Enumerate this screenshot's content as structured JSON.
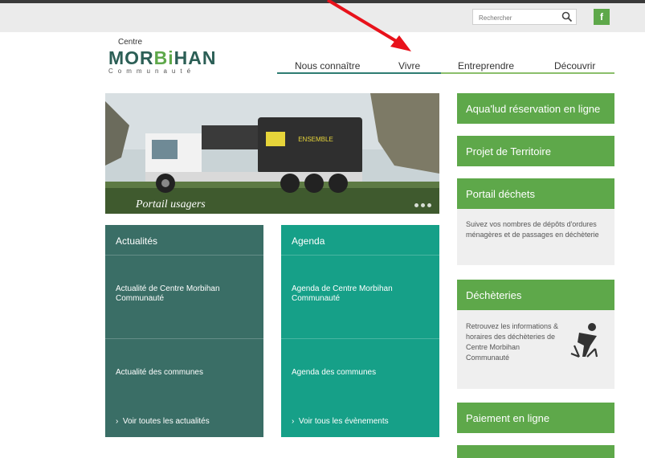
{
  "search": {
    "placeholder": "Rechercher"
  },
  "social": {
    "facebook_label": "f"
  },
  "logo": {
    "line1": "Centre",
    "line2a": "MOR",
    "line2b": "Bi",
    "line2c": "HAN",
    "line3": "Communauté"
  },
  "nav": {
    "items": [
      "Nous connaître",
      "Vivre",
      "Entreprendre",
      "Découvrir"
    ]
  },
  "hero": {
    "caption": "Portail usagers",
    "truck_text": "ENSEMBLE"
  },
  "tiles": {
    "actualites": {
      "title": "Actualités",
      "item1": "Actualité de Centre Morbihan Communauté",
      "item2": "Actualité des communes",
      "more": "Voir toutes les actualités"
    },
    "agenda": {
      "title": "Agenda",
      "item1": "Agenda de Centre Morbihan Communauté",
      "item2": "Agenda des communes",
      "more": "Voir tous les évènements"
    }
  },
  "sidebar": {
    "aqualud": "Aqua'lud réservation en ligne",
    "projet": "Projet de Territoire",
    "portail": "Portail déchets",
    "portail_text": "Suivez vos nombres de dépôts d'ordures ménagères et de passages en déchèterie",
    "decheteries": "Déchèteries",
    "decheteries_text": "Retrouvez les informations & horaires des déchèteries de Centre Morbihan Communauté",
    "paiement": "Paiement en ligne"
  },
  "colors": {
    "brand_green": "#5ea84a",
    "dark_teal": "#3a6e66",
    "teal": "#16a088",
    "annotation": "#e8121b"
  }
}
